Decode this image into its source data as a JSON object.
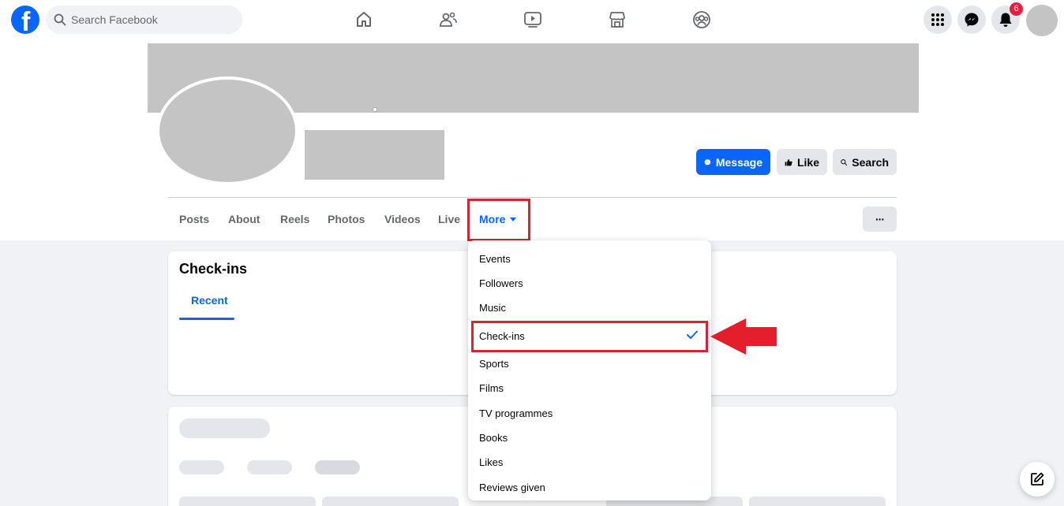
{
  "topbar": {
    "logo_letter": "f",
    "search_placeholder": "Search Facebook",
    "nav_icons": [
      "home-icon",
      "friends-icon",
      "watch-icon",
      "marketplace-icon",
      "groups-icon"
    ],
    "notification_count": "6"
  },
  "profile": {
    "buttons": {
      "message": "Message",
      "like": "Like",
      "search": "Search"
    },
    "tabs": [
      "Posts",
      "About",
      "Reels",
      "Photos",
      "Videos",
      "Live"
    ],
    "more_tab": "More",
    "dots_label": "···"
  },
  "checkins_card": {
    "title": "Check-ins",
    "subtab": "Recent"
  },
  "dropdown": {
    "items": [
      "Events",
      "Followers",
      "Music",
      "Check-ins",
      "Sports",
      "Films",
      "TV programmes",
      "Books",
      "Likes",
      "Reviews given"
    ],
    "selected": "Check-ins"
  },
  "colors": {
    "accent": "#0866ff",
    "highlight": "#d9232e",
    "badge": "#e41e3f"
  }
}
